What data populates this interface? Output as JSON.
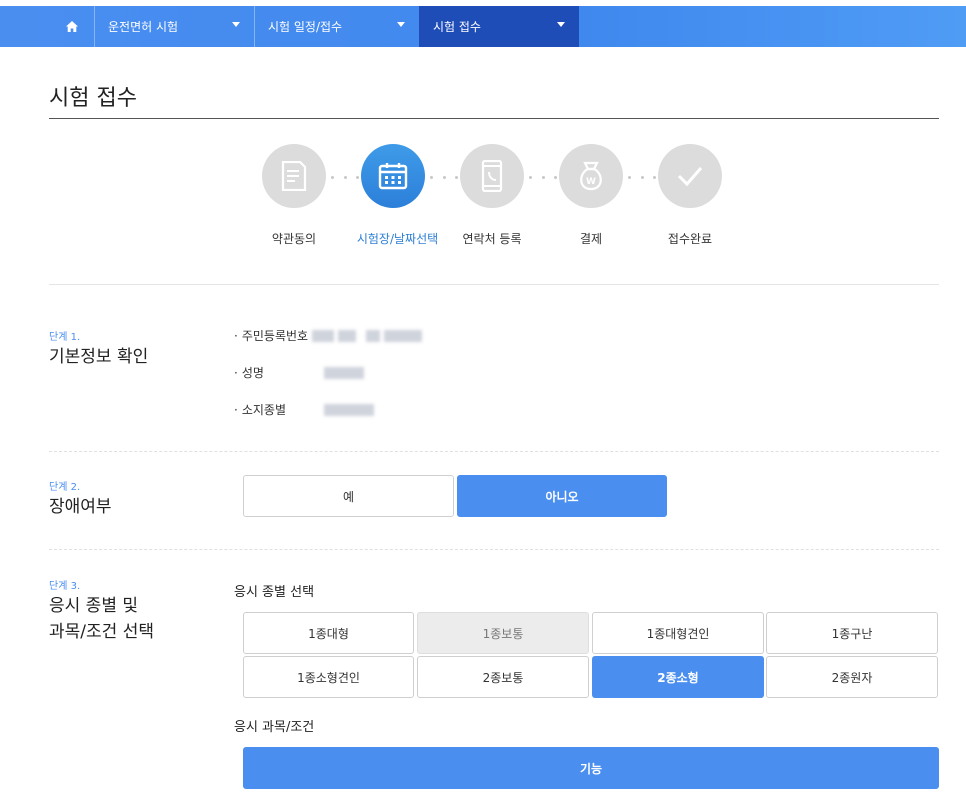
{
  "nav": {
    "home_icon": "home-icon",
    "items": [
      {
        "label": "운전면허 시험"
      },
      {
        "label": "시험 일정/접수"
      },
      {
        "label": "시험 접수"
      }
    ]
  },
  "page": {
    "title": "시험 접수"
  },
  "steps": [
    {
      "label": "약관동의",
      "icon": "document-icon",
      "active": false
    },
    {
      "label": "시험장/날짜선택",
      "icon": "calendar-icon",
      "active": true
    },
    {
      "label": "연락처 등록",
      "icon": "phone-icon",
      "active": false
    },
    {
      "label": "결제",
      "icon": "won-bag-icon",
      "active": false
    },
    {
      "label": "접수완료",
      "icon": "check-icon",
      "active": false
    }
  ],
  "stage1": {
    "no": "단계 1.",
    "title": "기본정보 확인",
    "fields": [
      {
        "label": "주민등록번호"
      },
      {
        "label": "성명"
      },
      {
        "label": "소지종별"
      }
    ]
  },
  "stage2": {
    "no": "단계 2.",
    "title": "장애여부",
    "options": [
      "예",
      "아니오"
    ],
    "selected": "아니오"
  },
  "stage3": {
    "no": "단계 3.",
    "title_line1": "응시 종별 및",
    "title_line2": "과목/조건 선택",
    "type_heading": "응시 종별 선택",
    "types": [
      "1종대형",
      "1종보통",
      "1종대형견인",
      "1종구난",
      "1종소형견인",
      "2종보통",
      "2종소형",
      "2종원자"
    ],
    "selected_type": "2종소형",
    "disabled_type": "1종보통",
    "subject_heading": "응시 과목/조건",
    "subject_button": "기능"
  },
  "colors": {
    "accent": "#4a8ef0",
    "nav_active": "#1f4db8",
    "step_active": "#2c7fd9"
  }
}
